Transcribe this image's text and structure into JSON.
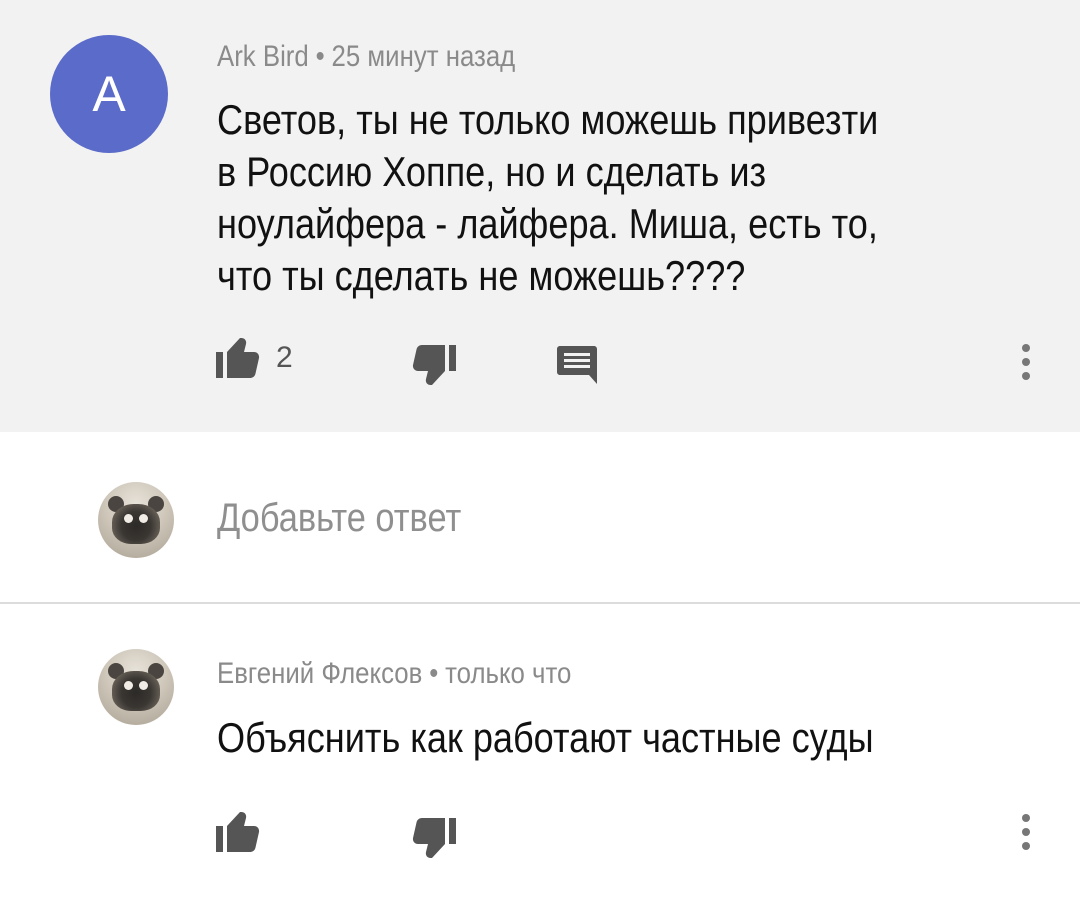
{
  "comment": {
    "avatar_letter": "A",
    "avatar_color": "#5b6bc9",
    "author": "Ark Bird",
    "separator": "•",
    "time": "25 минут назад",
    "text_lines": [
      "Светов, ты не только можешь привезти",
      "в Россию Хоппе, но и сделать из",
      "ноулайфера - лайфера. Миша, есть то,",
      "что ты сделать не можешь????"
    ],
    "likes": "2",
    "icons": [
      "thumb-up-icon",
      "thumb-down-icon",
      "reply-icon",
      "more-vert-icon"
    ]
  },
  "reply_box": {
    "placeholder": "Добавьте ответ"
  },
  "reply": {
    "author": "Евгений Флексов",
    "separator": "•",
    "time": "только что",
    "text": "Объяснить как работают частные суды",
    "icons": [
      "thumb-up-icon",
      "thumb-down-icon",
      "more-vert-icon"
    ]
  }
}
